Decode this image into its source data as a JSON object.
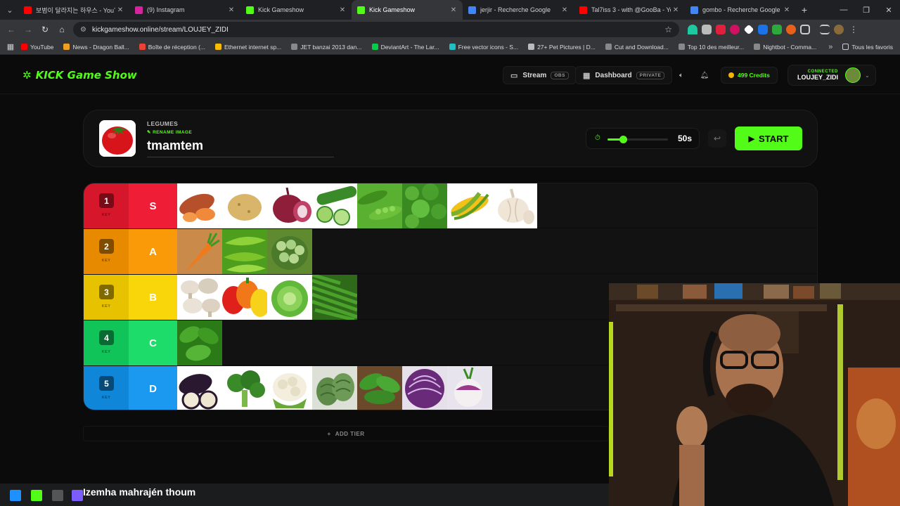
{
  "browser": {
    "tabs": [
      {
        "title": "보범이 달라지는 하우스 - YouT",
        "color": "#ff0000",
        "active": false
      },
      {
        "title": "(9) Instagram",
        "color": "#d6249f",
        "active": false
      },
      {
        "title": "Kick Gameshow",
        "color": "#53fc18",
        "active": false
      },
      {
        "title": "Kick Gameshow",
        "color": "#53fc18",
        "active": true
      },
      {
        "title": "jerjir - Recherche Google",
        "color": "#4285f4",
        "active": false
      },
      {
        "title": "Tal7iss 3 - with @GooBa - YouT",
        "color": "#ff0000",
        "active": false
      },
      {
        "title": "gombo - Recherche Google",
        "color": "#4285f4",
        "active": false
      }
    ],
    "url": "kickgameshow.online/stream/LOUJEY_ZIDI",
    "bookmarks": [
      {
        "label": "YouTube",
        "color": "#ff0000"
      },
      {
        "label": "News - Dragon Ball...",
        "color": "#f0a020"
      },
      {
        "label": "Boîte de réception (...",
        "color": "#ea4335"
      },
      {
        "label": "Ethernet internet sp...",
        "color": "#fbbc04"
      },
      {
        "label": "JET banzai 2013 dan...",
        "color": "#888888"
      },
      {
        "label": "DeviantArt - The Lar...",
        "color": "#05cc47"
      },
      {
        "label": "Free vector icons - S...",
        "color": "#20c0c0"
      },
      {
        "label": "27+ Pet Pictures | D...",
        "color": "#bbbbbb"
      },
      {
        "label": "Cut and Download...",
        "color": "#888888"
      },
      {
        "label": "Top 10 des meilleur...",
        "color": "#888888"
      },
      {
        "label": "Nightbot - Comma...",
        "color": "#888888"
      }
    ],
    "all_favorites": "Tous les favoris"
  },
  "site": {
    "logo": "KICK Game Show",
    "nav_stream": "Stream",
    "nav_stream_tag": "OBS",
    "nav_dashboard": "Dashboard",
    "nav_dashboard_tag": "PRIVATE",
    "credits": "499 Credits",
    "user_status": "CONNECTED",
    "username": "LOUJEY_ZIDI",
    "accent": "#53fc18"
  },
  "card": {
    "category": "LEGUMES",
    "rename_label": "RENAME IMAGE",
    "image_name": "tmamtem",
    "timer_value": "50s",
    "timer_fraction": 0.25,
    "start_label": "START"
  },
  "tiers": [
    {
      "num": "1",
      "key": "KEY",
      "letter": "S",
      "num_color": "#d5162b",
      "letter_color": "#ef1d35",
      "items": [
        "sweet-potato",
        "potato",
        "red-onion",
        "cucumber",
        "peas",
        "parsley",
        "corn",
        "garlic"
      ]
    },
    {
      "num": "2",
      "key": "KEY",
      "letter": "A",
      "num_color": "#e88a00",
      "letter_color": "#fb9a08",
      "items": [
        "carrot",
        "green-pepper",
        "fava-beans"
      ]
    },
    {
      "num": "3",
      "key": "KEY",
      "letter": "B",
      "num_color": "#e6c200",
      "letter_color": "#f9d60a",
      "items": [
        "mushrooms",
        "bell-peppers",
        "lettuce",
        "green-beans"
      ]
    },
    {
      "num": "4",
      "key": "KEY",
      "letter": "C",
      "num_color": "#10c45a",
      "letter_color": "#1edc6a",
      "items": [
        "spinach"
      ]
    },
    {
      "num": "5",
      "key": "KEY",
      "letter": "D",
      "num_color": "#0f86d8",
      "letter_color": "#1b98f0",
      "items": [
        "eggplant",
        "broccoli",
        "cauliflower",
        "artichoke",
        "arugula",
        "red-cabbage",
        "turnip"
      ]
    }
  ],
  "add_tier": "ADD TIER",
  "caption": "Izemha mahrajén thoum"
}
